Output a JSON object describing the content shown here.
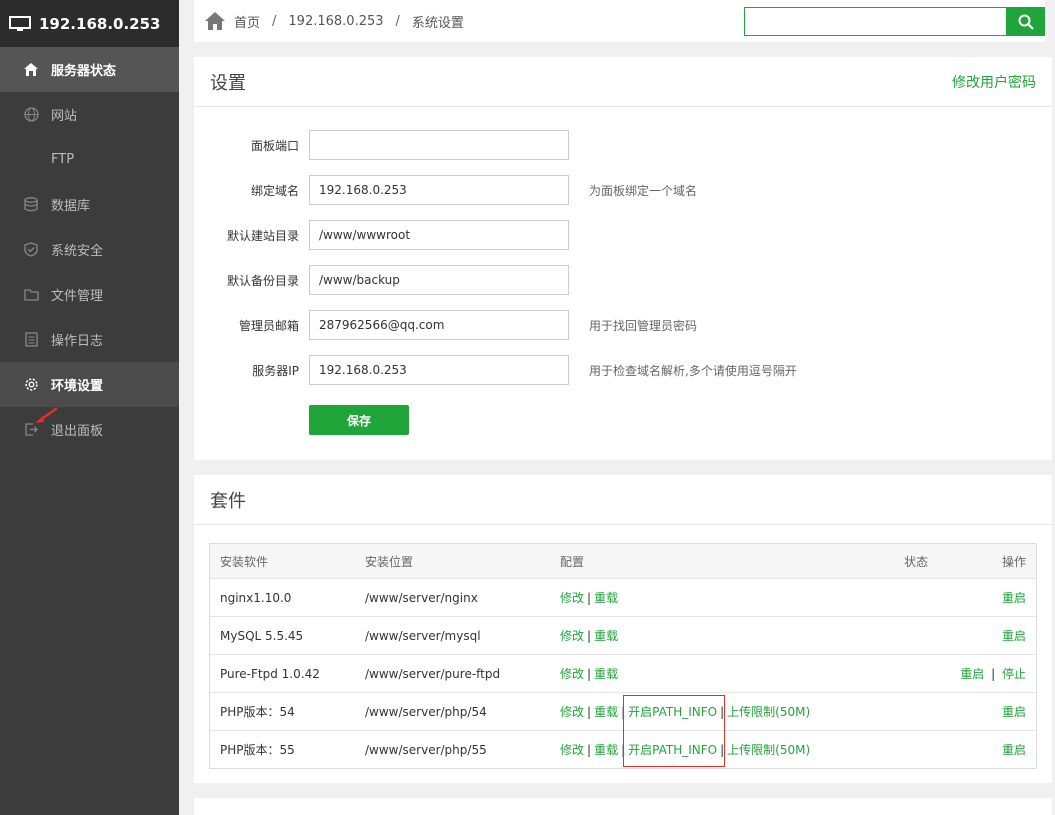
{
  "sidebar": {
    "host": "192.168.0.253",
    "items": [
      {
        "label": "服务器状态",
        "icon": "home-icon"
      },
      {
        "label": "网站",
        "icon": "globe-icon"
      },
      {
        "label": "FTP",
        "icon": "ftp-icon"
      },
      {
        "label": "数据库",
        "icon": "database-icon"
      },
      {
        "label": "系统安全",
        "icon": "shield-icon"
      },
      {
        "label": "文件管理",
        "icon": "folder-icon"
      },
      {
        "label": "操作日志",
        "icon": "log-icon"
      },
      {
        "label": "环境设置",
        "icon": "gear-icon"
      },
      {
        "label": "退出面板",
        "icon": "logout-icon"
      }
    ]
  },
  "breadcrumb": {
    "home": "首页",
    "sep1": "/",
    "host": "192.168.0.253",
    "sep2": "/",
    "current": "系统设置"
  },
  "search": {
    "value": "",
    "placeholder": ""
  },
  "settings": {
    "title": "设置",
    "change_password": "修改用户密码",
    "fields": [
      {
        "label": "面板端口",
        "value": "",
        "hint": ""
      },
      {
        "label": "绑定域名",
        "value": "192.168.0.253",
        "hint": "为面板绑定一个域名"
      },
      {
        "label": "默认建站目录",
        "value": "/www/wwwroot",
        "hint": ""
      },
      {
        "label": "默认备份目录",
        "value": "/www/backup",
        "hint": ""
      },
      {
        "label": "管理员邮箱",
        "value": "287962566@qq.com",
        "hint": "用于找回管理员密码"
      },
      {
        "label": "服务器IP",
        "value": "192.168.0.253",
        "hint": "用于检查域名解析,多个请使用逗号隔开"
      }
    ],
    "save_label": "保存"
  },
  "suite": {
    "title": "套件",
    "headers": {
      "software": "安装软件",
      "location": "安装位置",
      "config": "配置",
      "status": "状态",
      "action": "操作"
    },
    "sep": "|",
    "rows": [
      {
        "software": "nginx1.10.0",
        "location": "/www/server/nginx",
        "edit": "修改",
        "reload": "重载",
        "extra1": "",
        "extra2": "",
        "restart": "重启",
        "stop": ""
      },
      {
        "software": "MySQL 5.5.45",
        "location": "/www/server/mysql",
        "edit": "修改",
        "reload": "重载",
        "extra1": "",
        "extra2": "",
        "restart": "重启",
        "stop": ""
      },
      {
        "software": "Pure-Ftpd 1.0.42",
        "location": "/www/server/pure-ftpd",
        "edit": "修改",
        "reload": "重载",
        "extra1": "",
        "extra2": "",
        "restart": "重启",
        "stop": "停止"
      },
      {
        "software": "PHP版本：54",
        "location": "/www/server/php/54",
        "edit": "修改",
        "reload": "重载",
        "extra1": "开启PATH_INFO",
        "extra2": "上传限制(50M)",
        "restart": "重启",
        "stop": ""
      },
      {
        "software": "PHP版本：55",
        "location": "/www/server/php/55",
        "edit": "修改",
        "reload": "重载",
        "extra1": "开启PATH_INFO",
        "extra2": "上传限制(50M)",
        "restart": "重启",
        "stop": ""
      }
    ]
  }
}
